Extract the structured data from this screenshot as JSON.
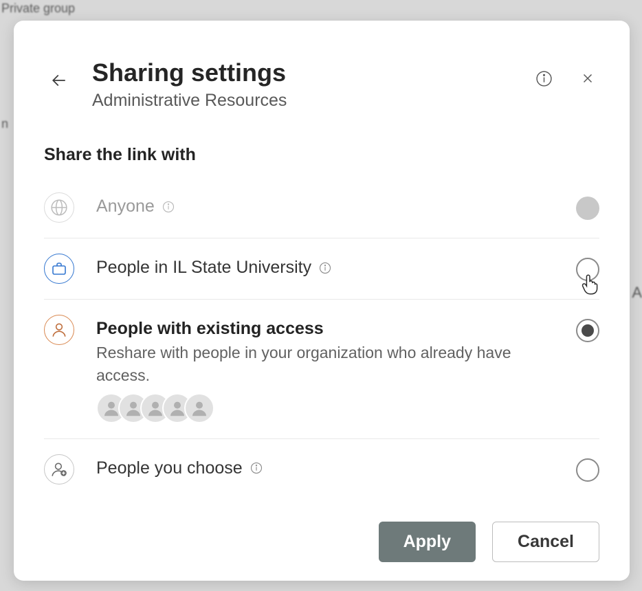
{
  "background": {
    "top_text": "Private group",
    "left_text": "n",
    "right_text": "A"
  },
  "dialog": {
    "title": "Sharing settings",
    "subtitle": "Administrative Resources",
    "section_title": "Share the link with",
    "options": [
      {
        "id": "anyone",
        "label": "Anyone",
        "has_info": true,
        "disabled": true,
        "selected": false
      },
      {
        "id": "org",
        "label": "People in IL State University",
        "has_info": true,
        "disabled": false,
        "selected": false
      },
      {
        "id": "existing",
        "label": "People with existing access",
        "description": "Reshare with people in your organization who already have access.",
        "has_info": false,
        "disabled": false,
        "selected": true,
        "avatar_count": 5
      },
      {
        "id": "choose",
        "label": "People you choose",
        "has_info": true,
        "disabled": false,
        "selected": false
      }
    ],
    "buttons": {
      "apply": "Apply",
      "cancel": "Cancel"
    }
  }
}
